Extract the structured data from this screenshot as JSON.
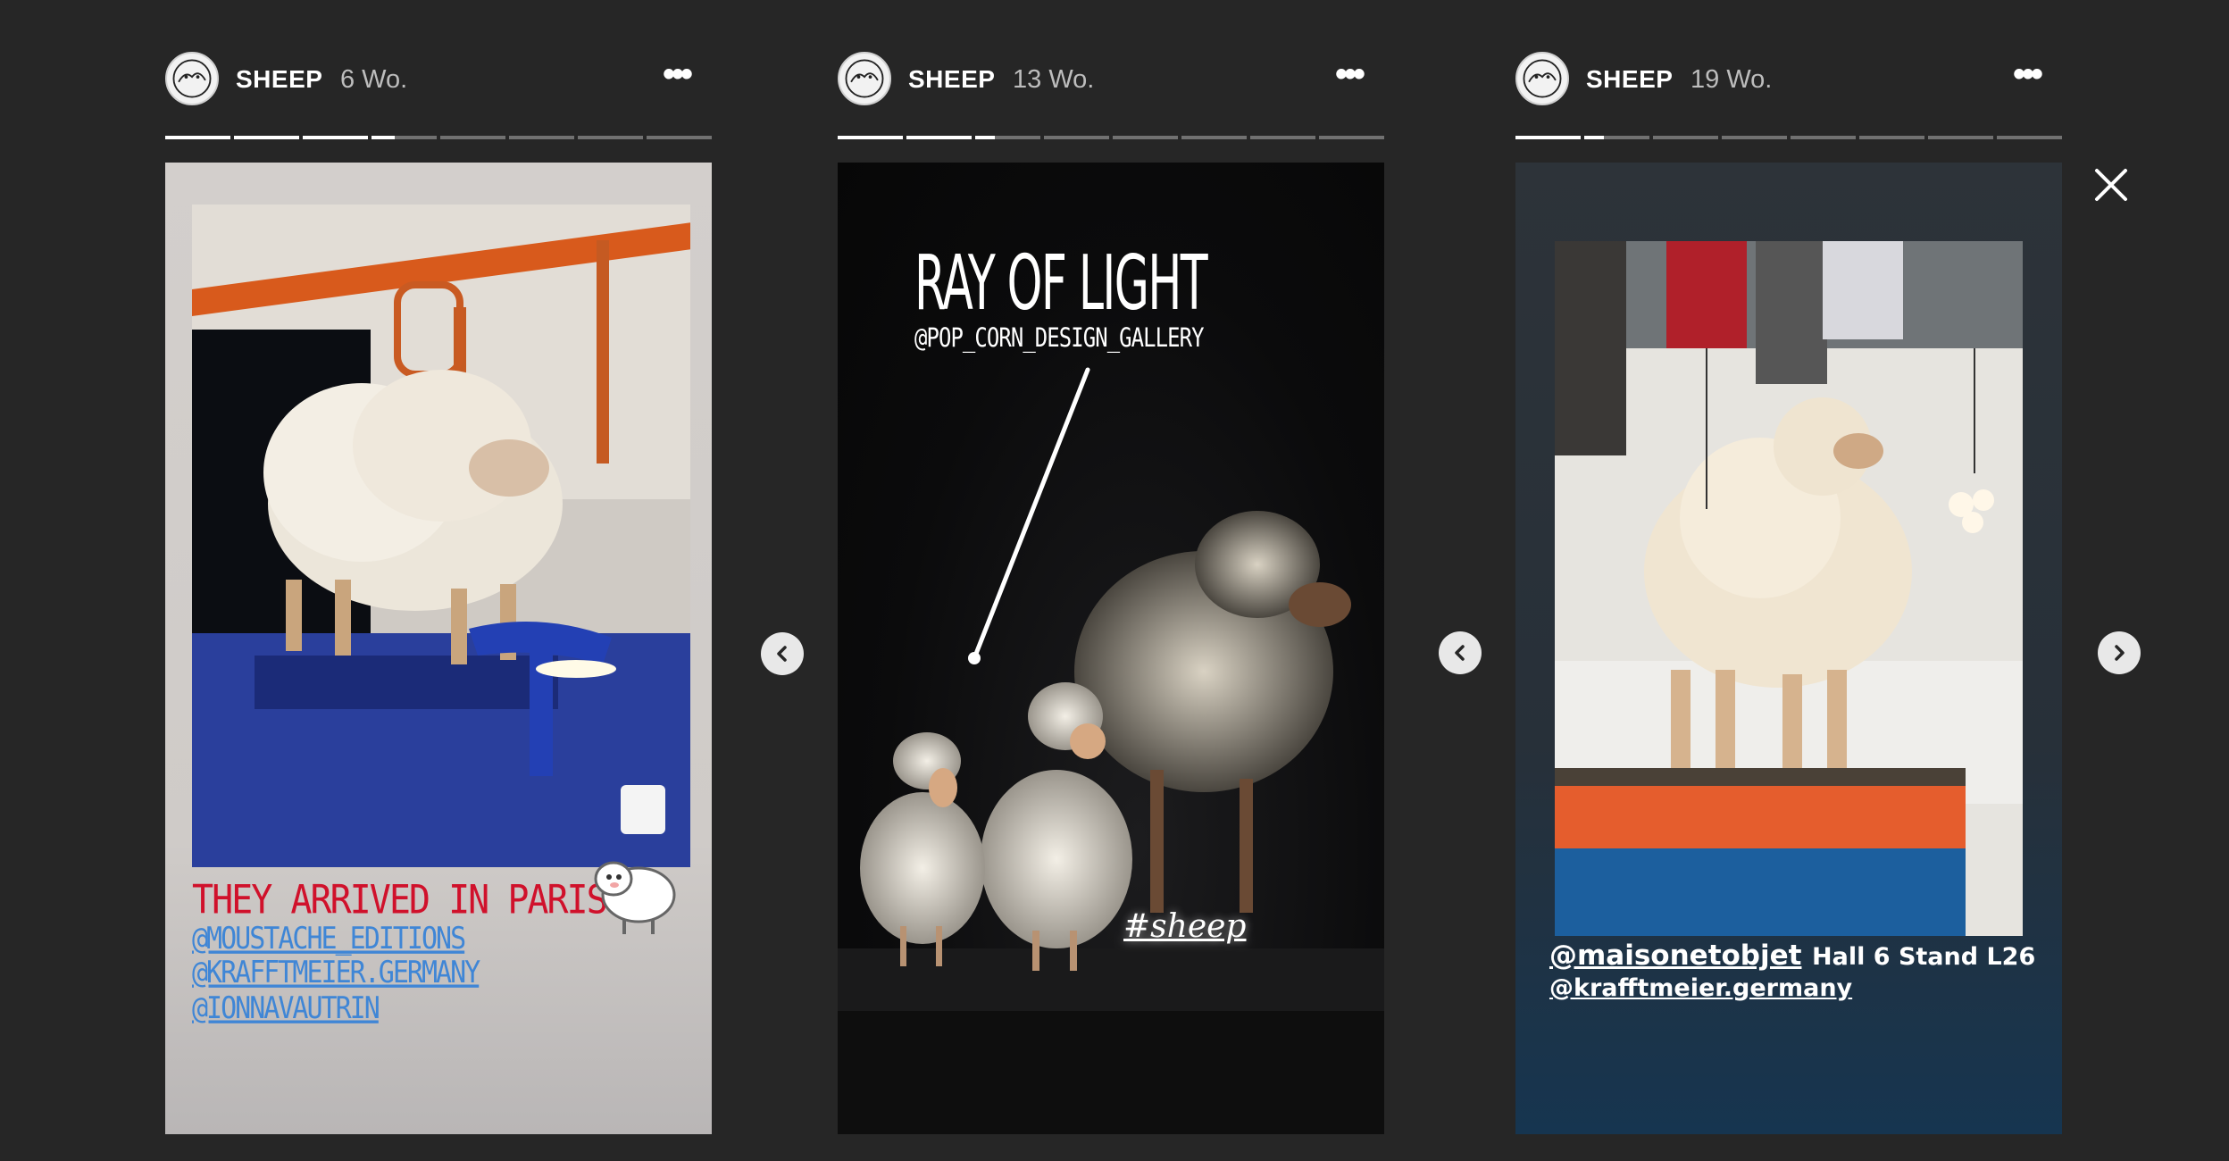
{
  "stories": [
    {
      "username": "SHEEP",
      "time": "6 Wo.",
      "progress": [
        1,
        1,
        1,
        0.35,
        0,
        0,
        0,
        0
      ],
      "caption": "THEY ARRIVED IN PARIS!",
      "mentions": [
        "@MOUSTACHE_EDITIONS",
        "@KRAFFTMEIER.GERMANY",
        "@IONNAVAUTRIN"
      ]
    },
    {
      "username": "SHEEP",
      "time": "13 Wo.",
      "progress": [
        1,
        1,
        0.3,
        0,
        0,
        0,
        0,
        0
      ],
      "title": "RAY OF LIGHT",
      "mention": "@POP_CORN_DESIGN_GALLERY",
      "hashtag": "#sheep"
    },
    {
      "username": "SHEEP",
      "time": "19 Wo.",
      "progress": [
        1,
        0.3,
        0,
        0,
        0,
        0,
        0,
        0
      ],
      "mention1": "@maisonetobjet",
      "location": "Hall 6 Stand L26",
      "mention2": "@krafftmeier.germany"
    }
  ],
  "icons": {
    "more": "more-options-icon",
    "prev": "chevron-left-icon",
    "next": "chevron-right-icon",
    "close": "close-icon"
  },
  "colors": {
    "background": "#262626",
    "caption_red": "#d0112b",
    "mention_blue": "#3f86d6"
  }
}
